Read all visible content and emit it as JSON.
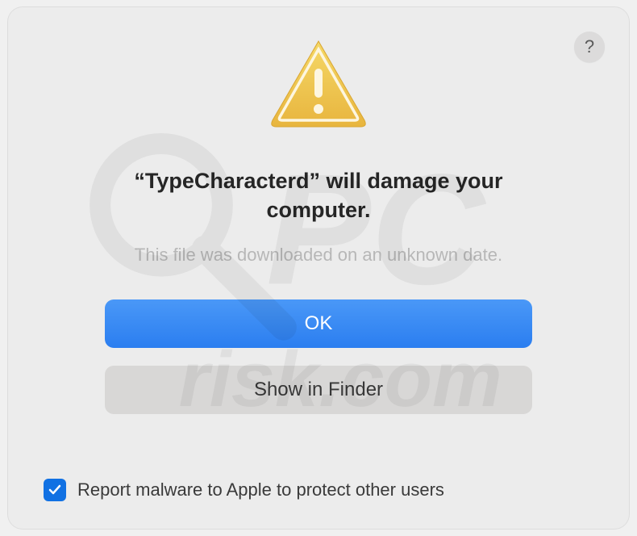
{
  "dialog": {
    "help_label": "?",
    "title": "“TypeCharacterd” will damage your computer.",
    "subtitle": "This file was downloaded on an unknown date.",
    "primary_button": "OK",
    "secondary_button": "Show in Finder",
    "checkbox_label": "Report malware to Apple to protect other users",
    "checkbox_checked": true
  },
  "colors": {
    "primary_button_bg": "#3386f3",
    "checkbox_bg": "#1171e3",
    "dialog_bg": "#ececec"
  }
}
